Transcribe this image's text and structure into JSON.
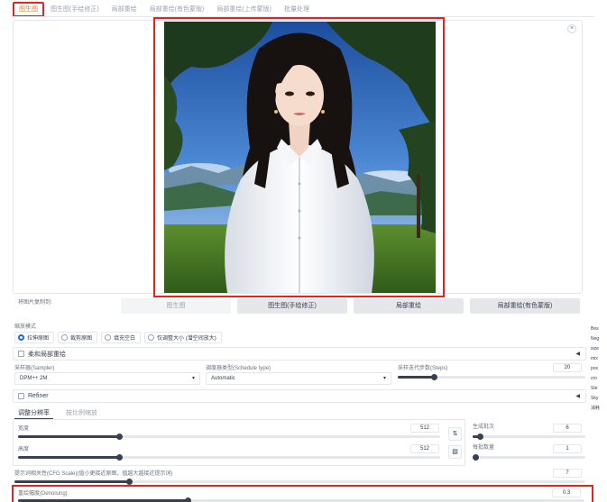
{
  "tabs": [
    "图生图",
    "图生图(手绘修正)",
    "局部重绘",
    "局部重绘(有色蒙版)",
    "局部重绘(上传蒙版)",
    "批量处理"
  ],
  "image_panel": {
    "close_label": "×",
    "photo_icon": "portrait-photo"
  },
  "copy_row": {
    "label": "将图片复制到:",
    "buttons": [
      "图生图",
      "图生图(手绘修正)",
      "局部重绘",
      "局部重绘(有色蒙版)"
    ]
  },
  "side_strip": [
    "Bes",
    "Neg",
    "size",
    "mix",
    "pos",
    "cro",
    "Ste",
    "Sky",
    "消耗"
  ],
  "resize_mode": {
    "label": "缩放模式",
    "options": [
      "拉伸原图",
      "裁剪原图",
      "填充空白",
      "仅调整大小 (潜空间放大)"
    ],
    "selected": 0
  },
  "soft_inpaint": {
    "label": "柔和局部重绘",
    "caret": "◀"
  },
  "sampler": {
    "label": "采样器(Sampler)",
    "value": "DPM++ 2M",
    "arrow": "▾"
  },
  "schedule": {
    "label": "调度器类型(Schedule type)",
    "value": "Automatic",
    "arrow": "▾"
  },
  "steps": {
    "label": "采样迭代步数(Steps)",
    "value": "20",
    "level": 0.19
  },
  "refiner": {
    "label": "Refiner",
    "caret": "◀"
  },
  "size_tabs": [
    "调整分辨率",
    "按比例缩放"
  ],
  "width": {
    "label": "宽度",
    "value": "512",
    "level": 0.24
  },
  "height": {
    "label": "高度",
    "value": "512",
    "level": 0.24
  },
  "swap_icon": "⇅",
  "ratio_icon": "▧",
  "batch_count": {
    "label": "生成批次",
    "value": "6",
    "level": 0.06
  },
  "batch_size": {
    "label": "每批数量",
    "value": "1",
    "level": 0.0
  },
  "cfg": {
    "label": "提示词相关性(CFG Scale)(值小更接近原图，值越大越接近提示词)",
    "value": "7",
    "level": 0.2
  },
  "denoise": {
    "label": "重绘幅度(Denoising)",
    "value": "0.3",
    "level": 0.3
  },
  "colors": {
    "accent": "#f97316",
    "highlight": "#dc2626",
    "radio": "#2563eb"
  }
}
